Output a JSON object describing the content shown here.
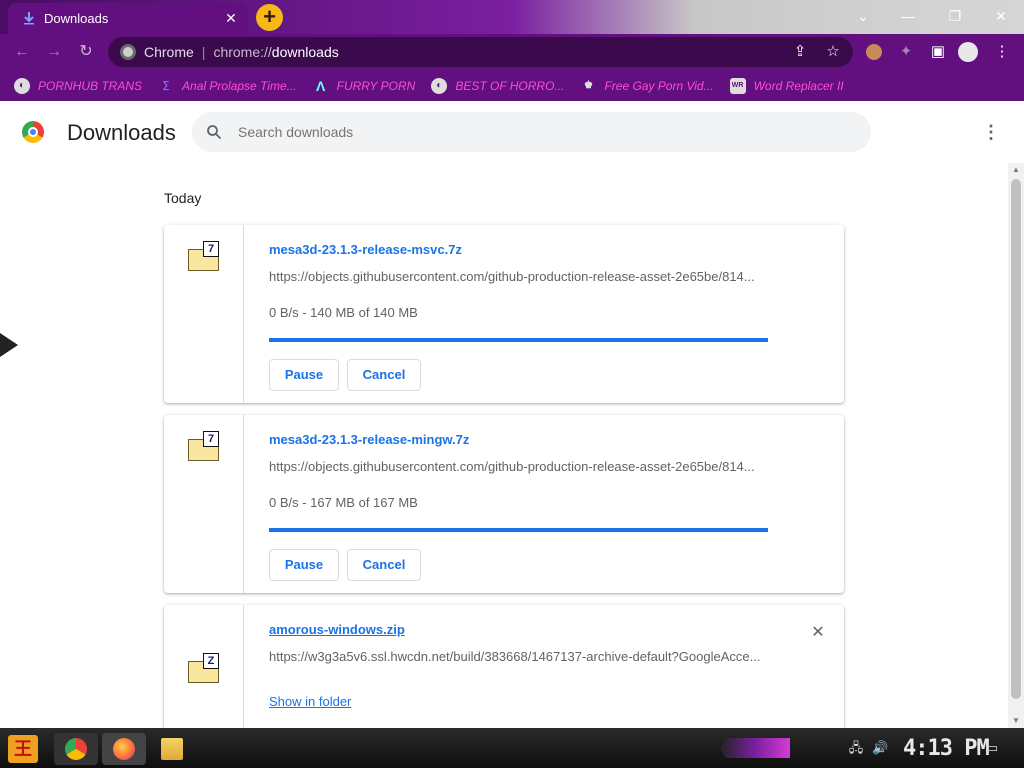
{
  "tab": {
    "title": "Downloads",
    "close_glyph": "✕",
    "new_tab_glyph": "+"
  },
  "window_controls": {
    "minimize": "—",
    "restore": "❐",
    "close": "✕",
    "tab_search": "⌄"
  },
  "omnibox": {
    "site_name": "Chrome",
    "separator": "|",
    "url_scheme": "chrome://",
    "url_path": "downloads"
  },
  "bookmarks": [
    {
      "label": "PORNHUB TRANS",
      "icon": "globe-icon"
    },
    {
      "label": "Anal Prolapse Time...",
      "icon": "strata-icon"
    },
    {
      "label": "FURRY PORN",
      "icon": "vector-icon"
    },
    {
      "label": "BEST OF HORRO...",
      "icon": "globe-icon"
    },
    {
      "label": "Free Gay Porn Vid...",
      "icon": "badge-icon"
    },
    {
      "label": "Word Replacer II",
      "icon": "wr-icon"
    }
  ],
  "page": {
    "title": "Downloads",
    "search_placeholder": "Search downloads",
    "date_heading": "Today",
    "menu_glyph": "⋮"
  },
  "downloads": [
    {
      "file_name": "mesa3d-23.1.3-release-msvc.7z",
      "url": "https://objects.githubusercontent.com/github-production-release-asset-2e65be/814...",
      "status": "0 B/s - 140 MB of 140 MB",
      "progress": 1.0,
      "icon_badge": "7",
      "pause_label": "Pause",
      "cancel_label": "Cancel"
    },
    {
      "file_name": "mesa3d-23.1.3-release-mingw.7z",
      "url": "https://objects.githubusercontent.com/github-production-release-asset-2e65be/814...",
      "status": "0 B/s - 167 MB of 167 MB",
      "progress": 1.0,
      "icon_badge": "7",
      "pause_label": "Pause",
      "cancel_label": "Cancel"
    },
    {
      "file_name": "amorous-windows.zip",
      "url": "https://w3g3a5v6.ssl.hwcdn.net/build/383668/1467137-archive-default?GoogleAcce...",
      "show_in_folder_label": "Show in folder",
      "icon_badge": "Z",
      "remove_glyph": "✕"
    }
  ],
  "taskbar": {
    "clock": "4:13 PM",
    "start_glyph": "王"
  },
  "colors": {
    "theme": "#62107f",
    "accent": "#1a73e8",
    "bookmark_text": "#ff4dd2"
  }
}
